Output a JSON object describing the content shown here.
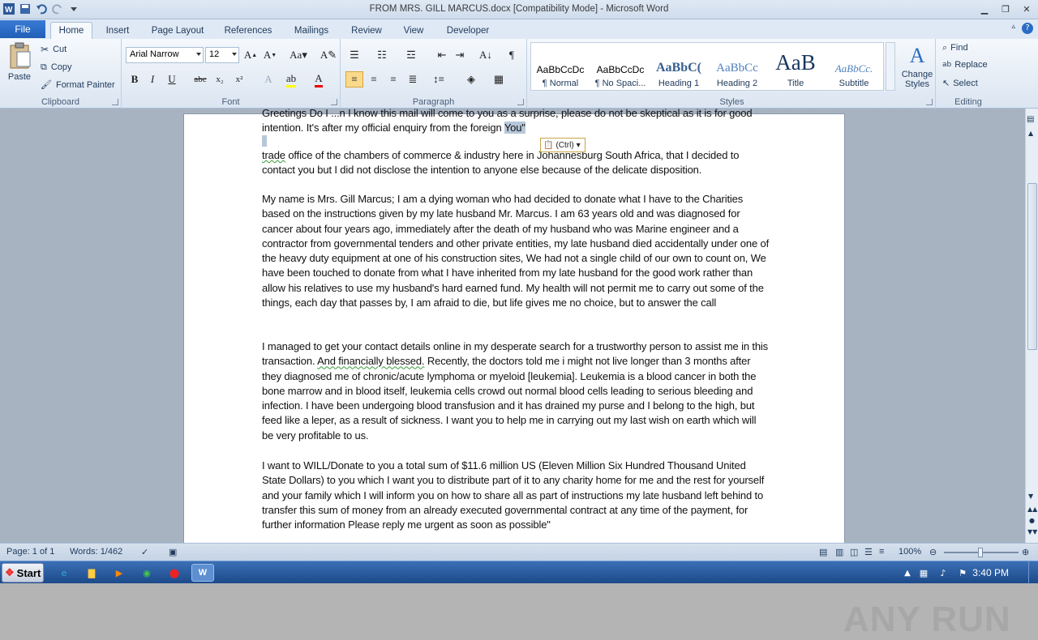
{
  "window": {
    "title": "FROM MRS. GILL MARCUS.docx [Compatibility Mode]  -  Microsoft Word"
  },
  "tabs": {
    "file": "File",
    "items": [
      "Home",
      "Insert",
      "Page Layout",
      "References",
      "Mailings",
      "Review",
      "View",
      "Developer"
    ],
    "active": "Home"
  },
  "ribbon": {
    "clipboard": {
      "label": "Clipboard",
      "paste": "Paste",
      "cut": "Cut",
      "copy": "Copy",
      "format_painter": "Format Painter"
    },
    "font": {
      "label": "Font",
      "family": "Arial Narrow",
      "size": "12"
    },
    "paragraph": {
      "label": "Paragraph"
    },
    "styles": {
      "label": "Styles",
      "items": [
        {
          "sample": "AaBbCcDc",
          "name": "¶ Normal"
        },
        {
          "sample": "AaBbCcDc",
          "name": "¶ No Spaci..."
        },
        {
          "sample": "AaBbC(",
          "name": "Heading 1"
        },
        {
          "sample": "AaBbCc",
          "name": "Heading 2"
        },
        {
          "sample": "AaB",
          "name": "Title"
        },
        {
          "sample": "AaBbCc.",
          "name": "Subtitle"
        }
      ],
      "change": "Change Styles"
    },
    "editing": {
      "label": "Editing",
      "find": "Find",
      "replace": "Replace",
      "select": "Select"
    }
  },
  "document": {
    "p0_line1": "Greetings Do I ...n I know this mail will come to you as a surprise, please do not be skeptical as it is for good",
    "p0_line2a": "intention.  It's after my official enquiry from the foreign ",
    "p0_sel": "You\"",
    "p1_word": "trade",
    "p1_rest": " office of the chambers of commerce & industry here in Johannesburg South Africa, that  I decided to contact you but I did not disclose the intention to anyone else because of the delicate disposition.",
    "p2": "My name is Mrs. Gill Marcus; I am a dying woman who had decided to donate what I have to the Charities based on the instructions given by my late husband Mr. Marcus. I am 63  years old and was diagnosed for cancer about four years ago, immediately after the death of my husband who was Marine engineer and a contractor from governmental tenders and other private entities, my late husband died accidentally under one of the heavy duty equipment at one of his construction sites, We had not a single child of our own to count on, We have been touched to donate from what I have inherited from my late husband for the good work rather than  allow his relatives to use my husband's hard earned fund. My health will not permit me to carry out some of the things, each day that  passes by, I am afraid to die, but life gives me no choice, but to answer the call",
    "p3a": "I managed to get your contact details online in my desperate search for a trustworthy  person to assist me in this transaction.  ",
    "p3sq": "And financially blessed.",
    "p3b": " Recently, the doctors told me i might not live longer than 3 months after they diagnosed me of chronic/acute lymphoma or myeloid [leukemia]. Leukemia is a blood cancer in both the bone marrow and in blood itself, leukemia cells crowd out normal blood cells leading to serious bleeding and infection. I have been undergoing blood transfusion and it has drained my purse and I belong to the high, but feed like a leper, as a result of sickness. I want you to help me in carrying out my last wish on earth which will be very profitable to us.",
    "p4": " I want to WILL/Donate  to you a total sum of $11.6  million US (Eleven Million Six Hundred Thousand United State Dollars) to you which I want you to distribute part of it to any charity home for me and the rest for yourself and your family which I will inform you on how to share all as part of instructions my late husband left behind to transfer this sum of money from an already executed governmental contract at any time of the payment, for further information  Please reply me urgent as soon as possible\"",
    "paste_options": "(Ctrl)"
  },
  "status": {
    "page": "Page: 1 of 1",
    "words": "Words: 1/462",
    "zoom": "100%"
  },
  "taskbar": {
    "start": "Start",
    "clock": "3:40 PM"
  },
  "watermark": "ANY RUN"
}
